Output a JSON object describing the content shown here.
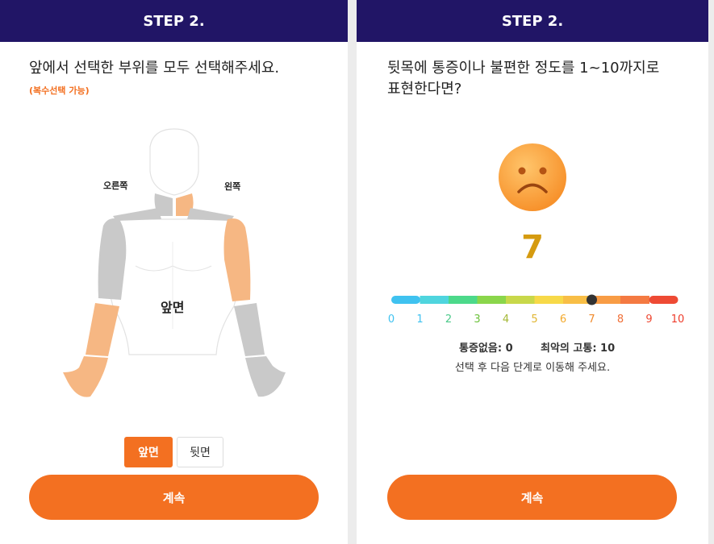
{
  "left": {
    "header": "STEP 2.",
    "question": "앞에서 선택한 부위를 모두 선택해주세요.",
    "note": "(복수선택 가능)",
    "label_right_side": "오른쪽",
    "label_left_side": "왼쪽",
    "view_label": "앞면",
    "toggle_front": "앞면",
    "toggle_back": "뒷면",
    "continue": "계속"
  },
  "right": {
    "header": "STEP 2.",
    "question_line1": "뒷목에 통증이나 불편한 정도를 1~10까지로",
    "question_line2": "표현한다면?",
    "score": "7",
    "scale": {
      "min": 0,
      "max": 10,
      "value": 7,
      "ticks": [
        "0",
        "1",
        "2",
        "3",
        "4",
        "5",
        "6",
        "7",
        "8",
        "9",
        "10"
      ],
      "colors": [
        "#3fc2f0",
        "#4fd5de",
        "#4cd98a",
        "#8ad64b",
        "#c8d84a",
        "#f7d948",
        "#f8be46",
        "#f89c45",
        "#f47a42",
        "#ee4a34"
      ]
    },
    "legend_none": "통증없음: 0",
    "legend_worst": "최악의 고통: 10",
    "hint": "선택 후 다음 단계로 이동해 주세요.",
    "continue": "계속"
  },
  "colors": {
    "accent": "#f37021",
    "header": "#211566",
    "selected_part": "#f6b783",
    "unselected_part": "#c9c9c9"
  }
}
